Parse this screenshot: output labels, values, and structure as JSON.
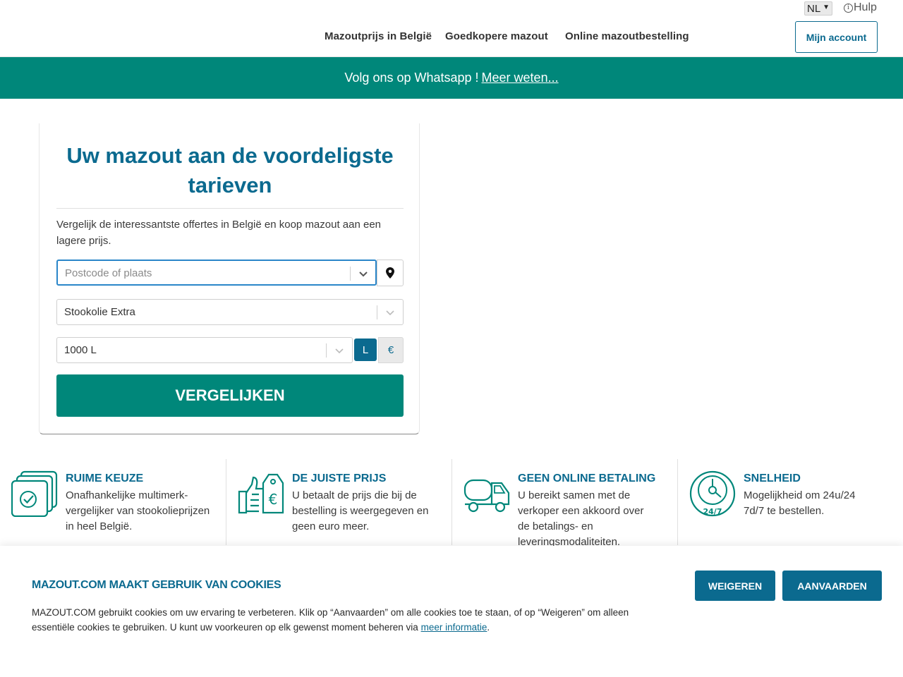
{
  "header": {
    "language": "NL",
    "help_label": "Hulp",
    "nav": [
      {
        "label": "Mazoutprijs in België"
      },
      {
        "label": "Goedkopere mazout"
      },
      {
        "label": "Online mazoutbestelling"
      }
    ],
    "account_label": "Mijn account"
  },
  "banner": {
    "text": "Volg ons op Whatsapp !",
    "link_label": "Meer weten..."
  },
  "search": {
    "title": "Uw mazout aan de voordeligste tarieven",
    "intro": "Vergelijk de interessantste offertes in België en koop mazout aan een lagere prijs.",
    "postcode_placeholder": "Postcode of plaats",
    "fuel_value": "Stookolie Extra",
    "quantity_value": "1000 L",
    "unit_liters": "L",
    "unit_euro": "€",
    "compare_label": "VERGELIJKEN"
  },
  "features": [
    {
      "title": "RUIME KEUZE",
      "text": "Onafhankelijke multimerk-vergelijker van stookolieprijzen in heel België.",
      "icon": "cards-check-icon"
    },
    {
      "title": "DE JUISTE PRIJS",
      "text": "U betaalt de prijs die bij de bestelling is weergegeven en geen euro meer.",
      "icon": "thumbs-up-euro-icon"
    },
    {
      "title": "GEEN ONLINE BETALING",
      "text": "U bereikt samen met de verkoper een akkoord over de betalings- en leveringsmodaliteiten.",
      "icon": "tanker-truck-icon"
    },
    {
      "title": "SNELHEID",
      "text": "Mogelijkheid om 24u/24 7d/7 te bestellen.",
      "icon": "clock-24-7-icon"
    }
  ],
  "cookie": {
    "title": "MAZOUT.COM MAAKT GEBRUIK VAN COOKIES",
    "text": "MAZOUT.COM gebruikt cookies om uw ervaring te verbeteren. Klik op “Aanvaarden” om alle cookies toe te staan, of op “Weigeren” om alleen essentiële cookies te gebruiken. U kunt uw voorkeuren op elk gewenst moment beheren via",
    "link_label": "meer informatie",
    "decline_label": "WEIGEREN",
    "accept_label": "AANVAARDEN"
  },
  "colors": {
    "primary_blue": "#0b6a8f",
    "teal": "#00877a"
  }
}
